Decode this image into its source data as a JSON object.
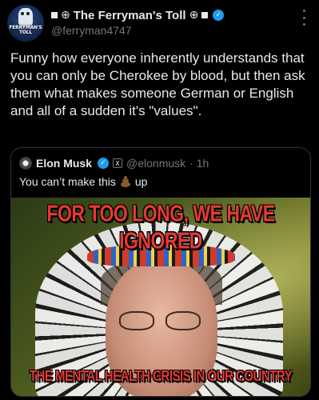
{
  "author": {
    "display_name": "The Ferryman's Toll",
    "name_prefix_glyph": "⊕",
    "name_suffix_glyph": "⊕",
    "handle": "@ferryman4747",
    "avatar_text": "FERRYMAN'S TOLL"
  },
  "post": {
    "text": "Funny how everyone inherently understands that you can only be Cherokee by blood, but then ask them what makes someone German or English and all of a sudden it's \"values\"."
  },
  "quoted": {
    "display_name": "Elon Musk",
    "handle": "@elonmusk",
    "time": "· 1h",
    "text_before": "You can’t make this",
    "text_after": "up",
    "image": {
      "top_caption": "FOR TOO LONG, WE HAVE IGNORED",
      "bottom_caption": "THE MENTAL HEALTH CRISIS IN OUR COUNTRY"
    }
  },
  "icons": {
    "verified": "verified-badge-icon",
    "more": "more-vertical-icon",
    "x_badge": "x-logo-icon",
    "emoji": "poop-emoji-icon"
  },
  "colors": {
    "background": "#000000",
    "text": "#e7e9ea",
    "muted": "#71767b",
    "verified": "#1d9bf0",
    "caption_red": "#e53935"
  }
}
